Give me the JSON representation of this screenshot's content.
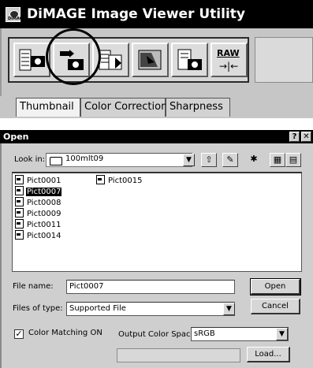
{
  "app": {
    "title": "DiMAGE Image Viewer Utility",
    "logo_text": "DiMAGE",
    "toolbar": [
      {
        "icon": "thumbnail-camera-icon"
      },
      {
        "icon": "camera-import-icon"
      },
      {
        "icon": "batch-convert-icon"
      },
      {
        "icon": "image-process-icon"
      },
      {
        "icon": "document-camera-icon"
      },
      {
        "icon": "raw-convert-icon",
        "label": "RAW",
        "arrow": "→|←"
      }
    ],
    "tabs": [
      "Thumbnail",
      "Color Correction",
      "Sharpness"
    ]
  },
  "dialog": {
    "title": "Open",
    "help_button": "?",
    "close_button": "✕",
    "look_in_label": "Look in:",
    "look_in_value": "100mlt09",
    "tools": [
      "⇧",
      "✎",
      "✱",
      "▦",
      "▤"
    ],
    "files_col1": [
      "Pict0001",
      "Pict0007",
      "Pict0008",
      "Pict0009",
      "Pict0011",
      "Pict0014"
    ],
    "files_col2": [
      "Pict0015"
    ],
    "selected_file": "Pict0007",
    "file_name_label": "File name:",
    "file_name_value": "Pict0007",
    "files_of_type_label": "Files of type:",
    "files_of_type_value": "Supported File",
    "open_button": "Open",
    "cancel_button": "Cancel",
    "color_matching_label": "Color Matching ON",
    "color_matching_checked": true,
    "output_color_space_label": "Output Color Space",
    "output_color_space_value": "sRGB",
    "load_button": "Load..."
  }
}
